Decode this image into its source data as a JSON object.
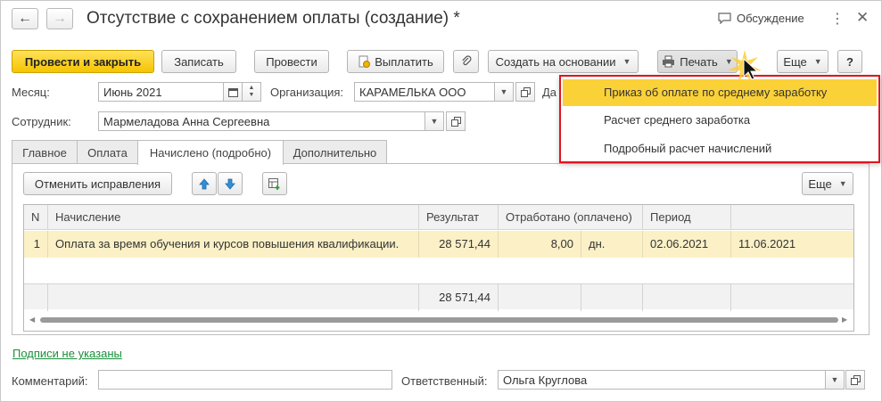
{
  "window": {
    "title": "Отсутствие с сохранением оплаты (создание) *",
    "discussion_label": "Обсуждение",
    "back_glyph": "←",
    "forward_glyph": "→",
    "more_glyph": "⋮",
    "close_glyph": "✕"
  },
  "toolbar": {
    "post_close": "Провести и закрыть",
    "save": "Записать",
    "post": "Провести",
    "pay": "Выплатить",
    "create_based_on": "Создать на основании",
    "print": "Печать",
    "more": "Еще",
    "help": "?"
  },
  "form": {
    "month_label": "Месяц:",
    "month_value": "Июнь 2021",
    "org_label": "Организация:",
    "org_value": "КАРАМЕЛЬКА ООО",
    "date_label_partial": "Да",
    "employee_label": "Сотрудник:",
    "employee_value": "Мармеладова Анна Сергеевна"
  },
  "tabs": [
    "Главное",
    "Оплата",
    "Начислено (подробно)",
    "Дополнительно"
  ],
  "panel": {
    "cancel_fixes": "Отменить исправления",
    "more": "Еще"
  },
  "table": {
    "headers": [
      "N",
      "Начисление",
      "Результат",
      "Отработано (оплачено)",
      "Период"
    ],
    "row": {
      "n": "1",
      "accrual": "Оплата за время обучения и курсов повышения квалификации.",
      "result": "28 571,44",
      "worked": "8,00",
      "unit": "дн.",
      "period_from": "02.06.2021",
      "period_to": "11.06.2021"
    },
    "total_result": "28 571,44"
  },
  "print_menu": {
    "items": [
      "Приказ об оплате по среднему заработку",
      "Расчет среднего заработка",
      "Подробный расчет начислений"
    ],
    "selected_index": 0
  },
  "footer": {
    "signatures_link": "Подписи не указаны",
    "comment_label": "Комментарий:",
    "comment_value": "",
    "responsible_label": "Ответственный:",
    "responsible_value": "Ольга Круглова"
  },
  "colors": {
    "primary_button": "#f5c400",
    "selected_row": "#fbf0c6",
    "menu_highlight": "#fbd138",
    "menu_border": "#e0141e",
    "link": "#1a8f3a"
  }
}
